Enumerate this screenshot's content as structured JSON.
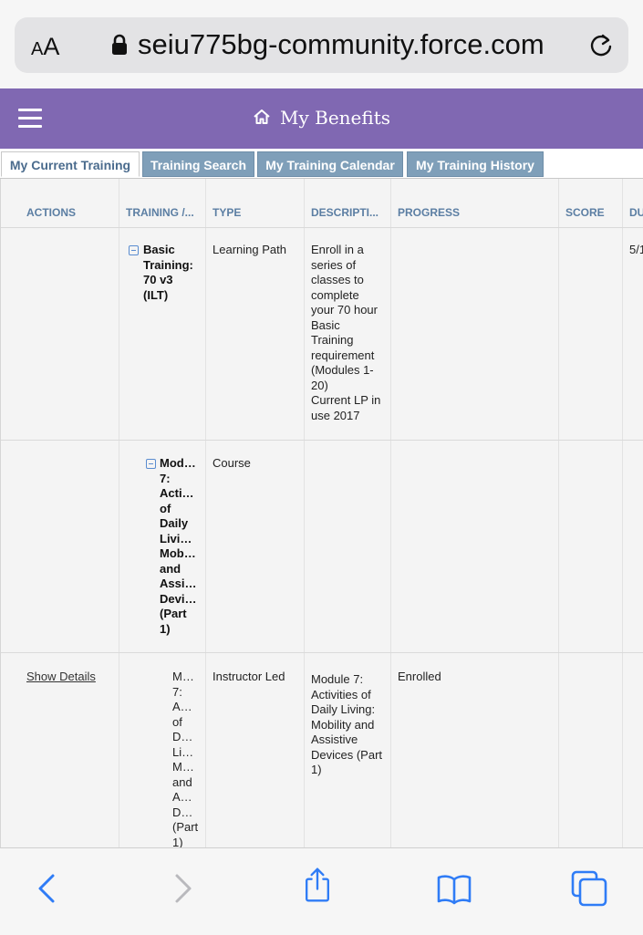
{
  "browser": {
    "aa_label_small": "A",
    "aa_label_big": "A",
    "url": "seiu775bg-community.force.com"
  },
  "header": {
    "title": "My Benefits"
  },
  "tabs": [
    {
      "label": "My Current Training",
      "active": true
    },
    {
      "label": "Training Search",
      "active": false
    },
    {
      "label": "My Training Calendar",
      "active": false
    },
    {
      "label": "My Training History",
      "active": false
    }
  ],
  "table": {
    "columns": [
      "ACTIONS",
      "TRAINING /...",
      "TYPE",
      "DESCRIPTI...",
      "PROGRESS",
      "SCORE",
      "DU"
    ],
    "rows": [
      {
        "actions": "",
        "training": [
          "Basic",
          "Training:",
          "70 v3",
          "(ILT)"
        ],
        "type": "Learning Path",
        "description": [
          "Enroll in a",
          "series of",
          "classes to",
          "complete",
          "your 70 hour",
          "Basic",
          "Training",
          "requirement",
          "(Modules 1-",
          "20)",
          "Current LP in",
          "use 2017"
        ],
        "progress": "",
        "score": "",
        "due": "5/1"
      },
      {
        "actions": "",
        "training": [
          "Mod…",
          "7:",
          "Acti…",
          "of",
          "Daily",
          "Livi…",
          "Mob…",
          "and",
          "Assi…",
          "Devi…",
          "(Part",
          "1)"
        ],
        "type": "Course",
        "description": [],
        "progress": "",
        "score": "",
        "due": ""
      },
      {
        "actions": "Show Details",
        "training": [
          "M…",
          "7:",
          "A…",
          "of",
          "D…",
          "Li…",
          "M…",
          "and",
          "A…",
          "D…",
          "(Part",
          "1)"
        ],
        "type": "Instructor Led",
        "description": [
          "Module 7:",
          "Activities of",
          "Daily Living:",
          "Mobility and",
          "Assistive",
          "Devices (Part",
          "1)"
        ],
        "progress": "Enrolled",
        "score": "",
        "due": ""
      }
    ]
  },
  "colors": {
    "header_purple": "#8068b2",
    "tab_blue": "#7f9fb9",
    "column_header_text": "#5b7ea3",
    "ios_blue": "#2f7cf6"
  },
  "icons": {
    "lock": "lock-icon",
    "reload": "reload-icon",
    "menu": "hamburger-menu-icon",
    "home": "home-icon",
    "collapse": "minus-square-icon",
    "back": "chevron-left-icon",
    "forward": "chevron-right-icon",
    "share": "share-icon",
    "bookmarks": "book-icon",
    "tabs": "tabs-icon"
  }
}
